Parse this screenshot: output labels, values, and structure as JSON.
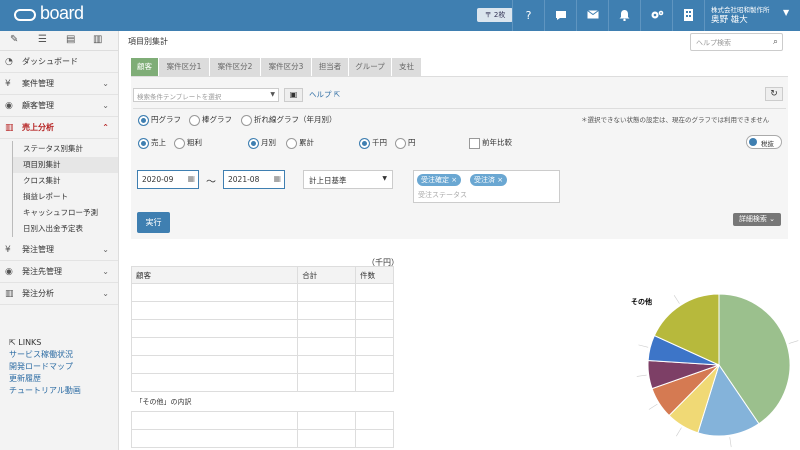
{
  "app": {
    "logo_text": "board"
  },
  "topbar": {
    "badge": "〒 2枚",
    "icons": [
      "help-icon",
      "chat-icon",
      "mail-icon",
      "bell-icon",
      "gears-icon",
      "building-icon"
    ],
    "help_glyph": "?",
    "company": "株式会社昭和製作所",
    "user": "奥野 雄大"
  },
  "sidebar": {
    "tools": [
      "pencil-icon",
      "list-icon",
      "card-icon",
      "bar-chart-icon"
    ],
    "dashboard": "ダッシュボード",
    "items": [
      {
        "label": "案件管理"
      },
      {
        "label": "顧客管理"
      },
      {
        "label": "売上分析"
      }
    ],
    "subitems": [
      "ステータス別集計",
      "項目別集計",
      "クロス集計",
      "損益レポート",
      "キャッシュフロー予測",
      "日別入出金予定表"
    ],
    "items2": [
      {
        "label": "発注管理"
      },
      {
        "label": "発注先管理"
      },
      {
        "label": "発注分析"
      }
    ],
    "links_title": "LINKS",
    "links": [
      "サービス稼働状況",
      "開発ロードマップ",
      "更新履歴",
      "チュートリアル動画"
    ]
  },
  "main": {
    "title": "項目別集計",
    "help_search_placeholder": "ヘルプ検索",
    "tabs": [
      "顧客",
      "案件区分1",
      "案件区分2",
      "案件区分3",
      "担当者",
      "グループ",
      "支社"
    ],
    "template_placeholder": "検索条件テンプレートを選択",
    "help_link": "ヘルプ",
    "note": "＊選択できない状態の設定は、現在のグラフでは利用できません",
    "graph_types": [
      "円グラフ",
      "棒グラフ",
      "折れ線グラフ（年月別）"
    ],
    "measure": [
      "売上",
      "粗利"
    ],
    "period": [
      "月別",
      "累計"
    ],
    "unit_opts": [
      "千円",
      "円"
    ],
    "prev_year": "前年比較",
    "tax_toggle": "税抜",
    "date_from": "2020-09",
    "date_tilde": "〜",
    "date_to": "2021-08",
    "base_select": "計上日基準",
    "status_chips": [
      "受注確定 ×",
      "受注済 ×"
    ],
    "status_placeholder": "受注ステータス",
    "run_button": "実行",
    "advanced_button": "詳細検索",
    "unit_label": "（千円）",
    "table_headers": [
      "顧客",
      "合計",
      "件数"
    ],
    "others_breakdown": "「その他」の内訳",
    "chart_data": {
      "type": "pie",
      "title": "",
      "labels": [
        "その他"
      ],
      "slices": [
        {
          "value": 40.5,
          "color": "#9bc08d"
        },
        {
          "value": 14.3,
          "color": "#84b3da"
        },
        {
          "value": 7.6,
          "color": "#f0d975"
        },
        {
          "value": 7.2,
          "color": "#d57a52"
        },
        {
          "value": 6.4,
          "color": "#7d3f66"
        },
        {
          "value": 5.8,
          "color": "#3d75c8"
        },
        {
          "value": 18.2,
          "color": "#b7b93c"
        }
      ]
    }
  }
}
